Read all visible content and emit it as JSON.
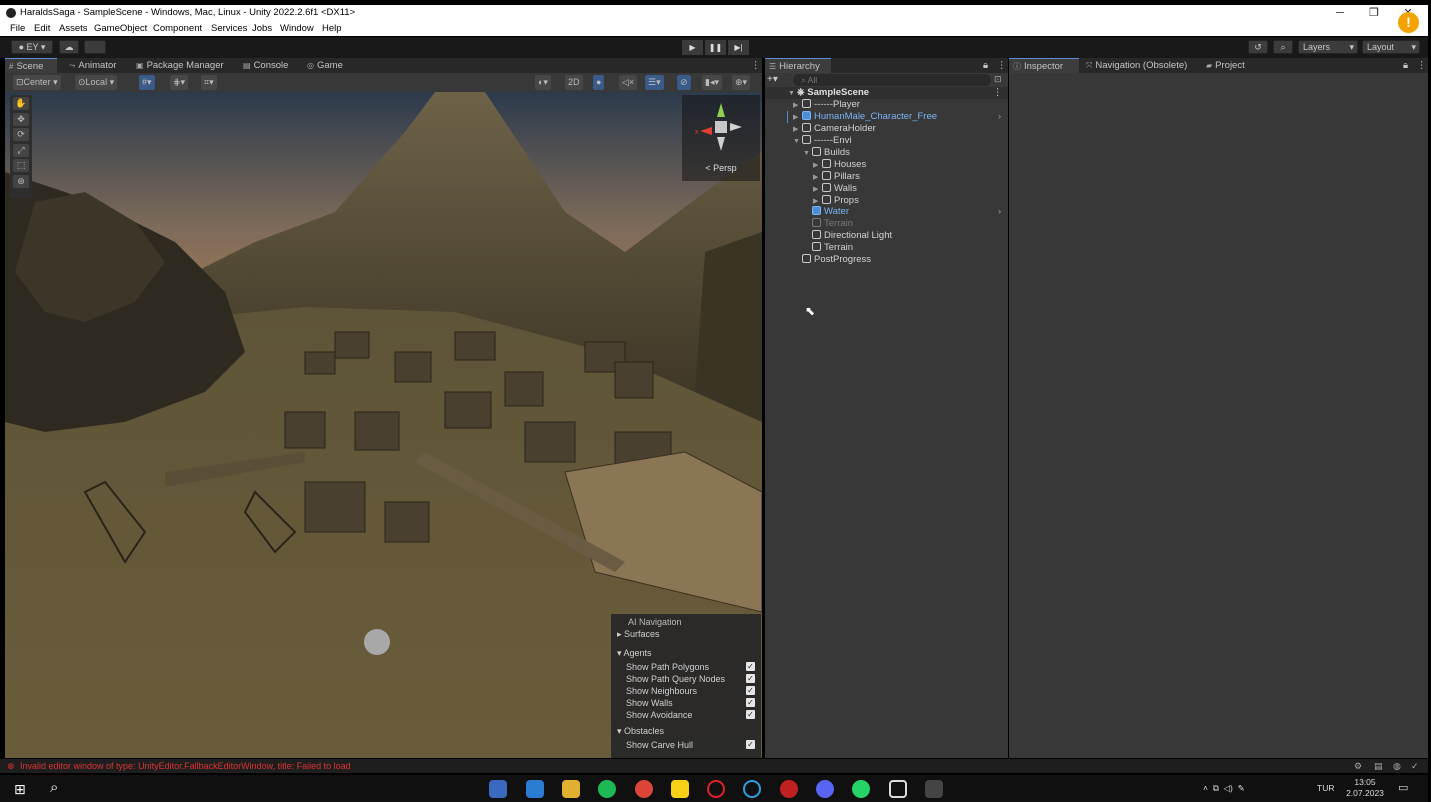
{
  "window": {
    "title": "HaraldsSaga - SampleScene - Windows, Mac, Linux - Unity 2022.2.6f1 <DX11>",
    "minimize": "─",
    "restore": "❐",
    "close": "✕"
  },
  "menu": {
    "items": [
      "File",
      "Edit",
      "Assets",
      "GameObject",
      "Component",
      "Services",
      "Jobs",
      "Window",
      "Help"
    ]
  },
  "toolbar": {
    "account": "EY",
    "layers": "Layers",
    "layout": "Layout",
    "play_icon": "play-icon",
    "pause_icon": "pause-icon",
    "step_icon": "step-icon"
  },
  "scene_tabs": [
    "Scene",
    "Animator",
    "Package Manager",
    "Console",
    "Game"
  ],
  "scene_toolbar": {
    "pivot": "Center",
    "space": "Local",
    "mode_2d": "2D"
  },
  "gizmo": {
    "projection": "Persp",
    "x_label": "x"
  },
  "nav_overlay": {
    "title": "AI Navigation",
    "sections": {
      "surfaces": "Surfaces",
      "agents": "Agents",
      "obstacles": "Obstacles"
    },
    "options": [
      {
        "label": "Show Path Polygons",
        "checked": true
      },
      {
        "label": "Show Path Query Nodes",
        "checked": true
      },
      {
        "label": "Show Neighbours",
        "checked": true
      },
      {
        "label": "Show Walls",
        "checked": true
      },
      {
        "label": "Show Avoidance",
        "checked": true
      }
    ],
    "obstacle_option": {
      "label": "Show Carve Hull",
      "checked": true
    }
  },
  "hierarchy": {
    "tab": "Hierarchy",
    "search_placeholder": "All",
    "scene": "SampleScene",
    "items": [
      {
        "label": "------Player",
        "style": "normal"
      },
      {
        "label": "HumanMale_Character_Free",
        "style": "blue"
      },
      {
        "label": "CameraHolder",
        "style": "normal"
      },
      {
        "label": "------Envi",
        "style": "normal"
      },
      {
        "label": "Builds",
        "style": "normal"
      },
      {
        "label": "Houses",
        "style": "normal"
      },
      {
        "label": "Pillars",
        "style": "normal"
      },
      {
        "label": "Walls",
        "style": "normal"
      },
      {
        "label": "Props",
        "style": "normal"
      },
      {
        "label": "Water",
        "style": "blue"
      },
      {
        "label": "Terrain",
        "style": "dim"
      },
      {
        "label": "Directional Light",
        "style": "normal"
      },
      {
        "label": "Terrain",
        "style": "normal"
      },
      {
        "label": "PostProgress",
        "style": "normal"
      }
    ]
  },
  "inspector_tabs": [
    "Inspector",
    "Navigation (Obsolete)",
    "Project"
  ],
  "status": {
    "message": "Invalid editor window of type: UnityEditor.FallbackEditorWindow, title: Failed to load"
  },
  "taskbar": {
    "lang": "TUR",
    "time": "13:05",
    "date": "2.07.2023"
  }
}
